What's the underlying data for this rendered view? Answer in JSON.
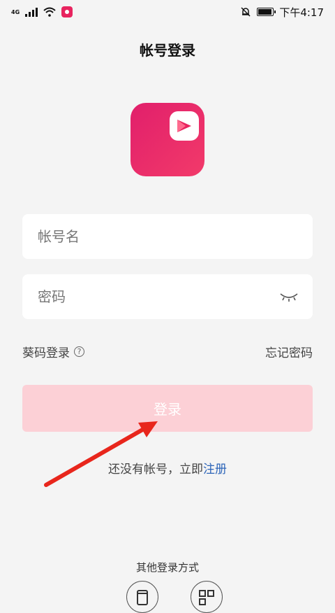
{
  "status_bar": {
    "network": "4G",
    "time": "下午4:17"
  },
  "header": {
    "title": "帐号登录"
  },
  "form": {
    "username_placeholder": "帐号名",
    "password_placeholder": "密码",
    "sms_login_label": "葵码登录",
    "forgot_password_label": "忘记密码",
    "login_button_label": "登录"
  },
  "register": {
    "prompt": "还没有帐号，立即",
    "link_label": "注册"
  },
  "other_login": {
    "title": "其他登录方式"
  },
  "colors": {
    "accent": "#e8245f",
    "button_disabled": "#fcd0d6",
    "link": "#2c64b8",
    "arrow": "#e8261c"
  }
}
